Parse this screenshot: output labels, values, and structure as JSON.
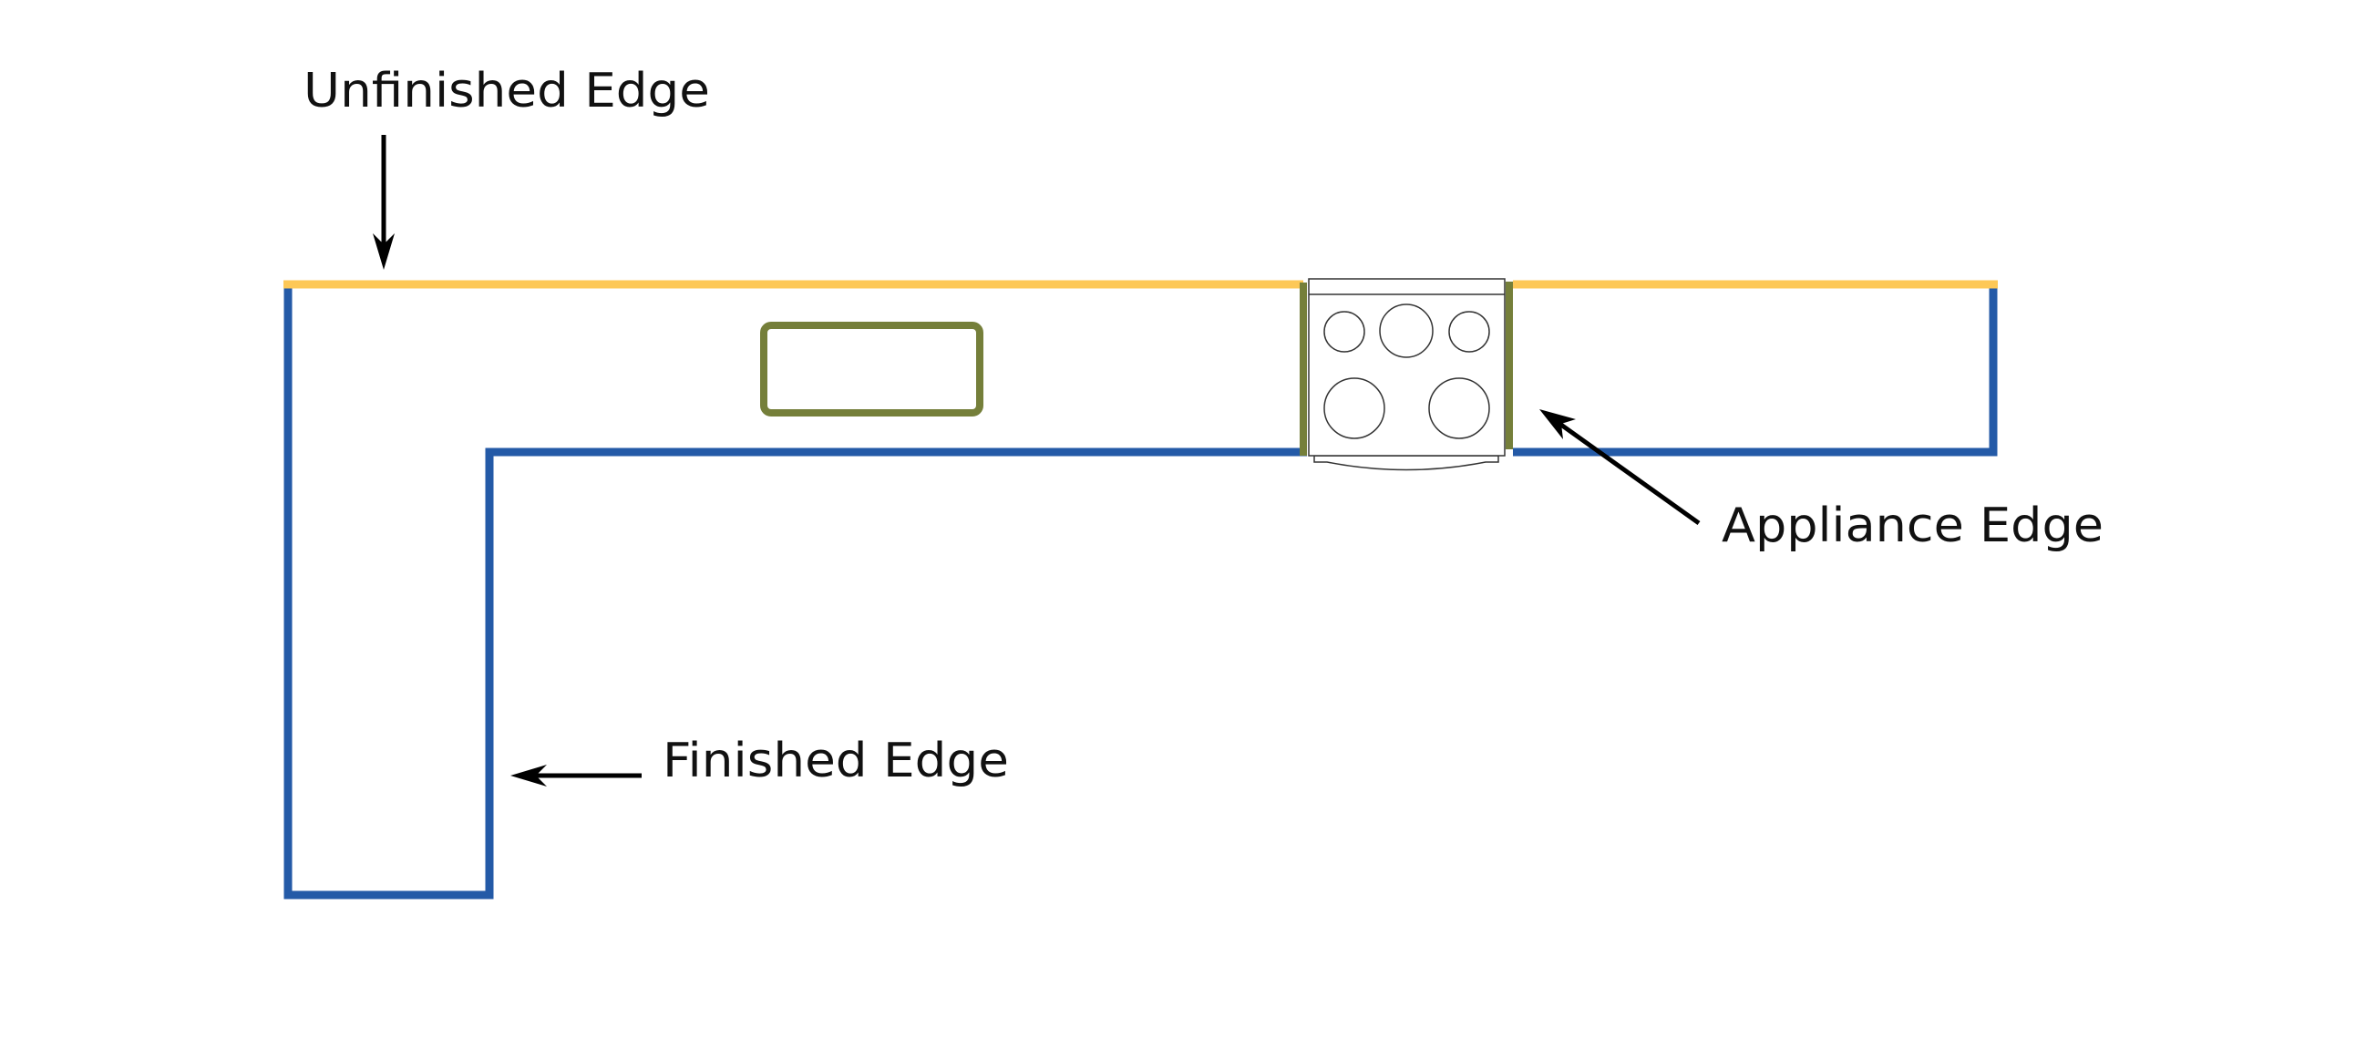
{
  "labels": {
    "unfinished": "Unfinished Edge",
    "appliance": "Appliance Edge",
    "finished": "Finished Edge"
  },
  "colors": {
    "unfinished_edge": "#FDC857",
    "finished_edge": "#245AA7",
    "appliance_edge": "#757F3A",
    "outline": "#333333",
    "arrow": "#000000"
  },
  "icons": {
    "sink": "sink-outline",
    "range": "cooktop-range-with-5-burners"
  }
}
